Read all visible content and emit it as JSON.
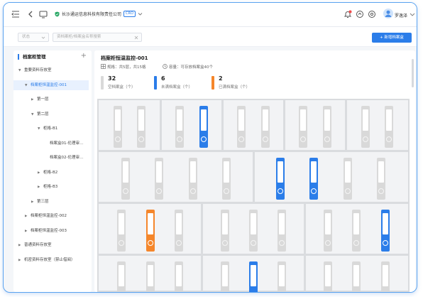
{
  "topbar": {
    "url_text": "长沙通运信息科技有限责任公司",
    "url_badge": "CRO",
    "user_name": "罗逸泽"
  },
  "filters": {
    "status_placeholder": "状态",
    "search_placeholder": "资档案柜/档案盒名称搜索",
    "new_button": "+ 新增档案盒"
  },
  "sidebar": {
    "title": "档案柜管理",
    "items": [
      {
        "label": "重要资料存放室",
        "indent": 0,
        "arrow": "down",
        "active": false
      },
      {
        "label": "档案柜恒温监控-001",
        "indent": 1,
        "arrow": "down",
        "active": true
      },
      {
        "label": "第一层",
        "indent": 2,
        "arrow": "right",
        "active": false
      },
      {
        "label": "第二层",
        "indent": 2,
        "arrow": "down",
        "active": false
      },
      {
        "label": "柜格-B1",
        "indent": 3,
        "arrow": "down",
        "active": false
      },
      {
        "label": "档案盒01-伦理审…",
        "indent": 4,
        "arrow": "",
        "active": false
      },
      {
        "label": "档案盒02-伦理审…",
        "indent": 4,
        "arrow": "",
        "active": false
      },
      {
        "label": "柜格-B2",
        "indent": 3,
        "arrow": "right",
        "active": false
      },
      {
        "label": "柜格-B3",
        "indent": 3,
        "arrow": "right",
        "active": false
      },
      {
        "label": "第三层",
        "indent": 2,
        "arrow": "right",
        "active": false
      },
      {
        "label": "档案柜恒温监控-002",
        "indent": 1,
        "arrow": "right",
        "active": false
      },
      {
        "label": "档案柜恒温监控-003",
        "indent": 1,
        "arrow": "right",
        "active": false
      },
      {
        "label": "普通资料存放室",
        "indent": 0,
        "arrow": "right",
        "active": false
      },
      {
        "label": "机密资料存放室（禁止借阅）",
        "indent": 0,
        "arrow": "right",
        "active": false
      }
    ]
  },
  "main": {
    "title": "档案柜恒温监控-001",
    "spec": "规格：共5层，共15格",
    "capacity": "容量：可存放档案盒40个",
    "stats": [
      {
        "num": "32",
        "label": "空档案盒（个）",
        "color": "#d9d9d9"
      },
      {
        "num": "6",
        "label": "未满档案盒（个）",
        "color": "#2b7de9"
      },
      {
        "num": "2",
        "label": "已满档案盒（个）",
        "color": "#f5862b"
      }
    ]
  },
  "cabinet": {
    "rows": [
      {
        "cells": [
          [
            "empty",
            "empty"
          ],
          [
            "empty",
            "unfiled"
          ],
          [
            "empty",
            "empty"
          ],
          [
            "empty",
            "empty"
          ],
          [
            "empty",
            "empty"
          ]
        ]
      },
      {
        "cells": [
          [
            "empty",
            "empty",
            "empty",
            "empty"
          ],
          [
            "unfiled",
            "unfiled",
            "empty",
            "empty"
          ]
        ]
      },
      {
        "cells": [
          [
            "empty",
            "used",
            "empty"
          ],
          [
            "empty",
            "empty",
            "empty"
          ],
          [
            "empty",
            "empty",
            "unfiled"
          ]
        ]
      },
      {
        "cells": [
          [
            "empty",
            "empty",
            "empty"
          ],
          [
            "empty",
            "unfiled",
            "empty"
          ],
          [
            "empty",
            "empty",
            "empty"
          ]
        ]
      }
    ]
  }
}
